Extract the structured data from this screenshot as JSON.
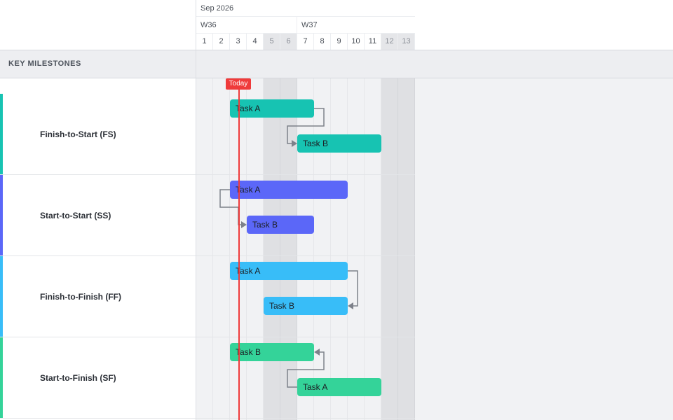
{
  "timeline": {
    "month": "Sep 2026",
    "weeks": [
      "W36",
      "W37"
    ],
    "days": [
      "1",
      "2",
      "3",
      "4",
      "5",
      "6",
      "7",
      "8",
      "9",
      "10",
      "11",
      "12",
      "13"
    ],
    "weekend_days": [
      "5",
      "6",
      "12",
      "13"
    ]
  },
  "section": {
    "label": "KEY MILESTONES"
  },
  "today": {
    "label": "Today",
    "color": "#ef3b3b"
  },
  "rows": [
    {
      "label": "Finish-to-Start (FS)",
      "color": "#17c3b2",
      "task1": "Task A",
      "task2": "Task B"
    },
    {
      "label": "Start-to-Start (SS)",
      "color": "#5b67f8",
      "task1": "Task A",
      "task2": "Task B"
    },
    {
      "label": "Finish-to-Finish (FF)",
      "color": "#38bdf8",
      "task1": "Task A",
      "task2": "Task B"
    },
    {
      "label": "Start-to-Finish (SF)",
      "color": "#34d399",
      "task1": "Task B",
      "task2": "Task A"
    }
  ],
  "link_color": "#7d818a"
}
